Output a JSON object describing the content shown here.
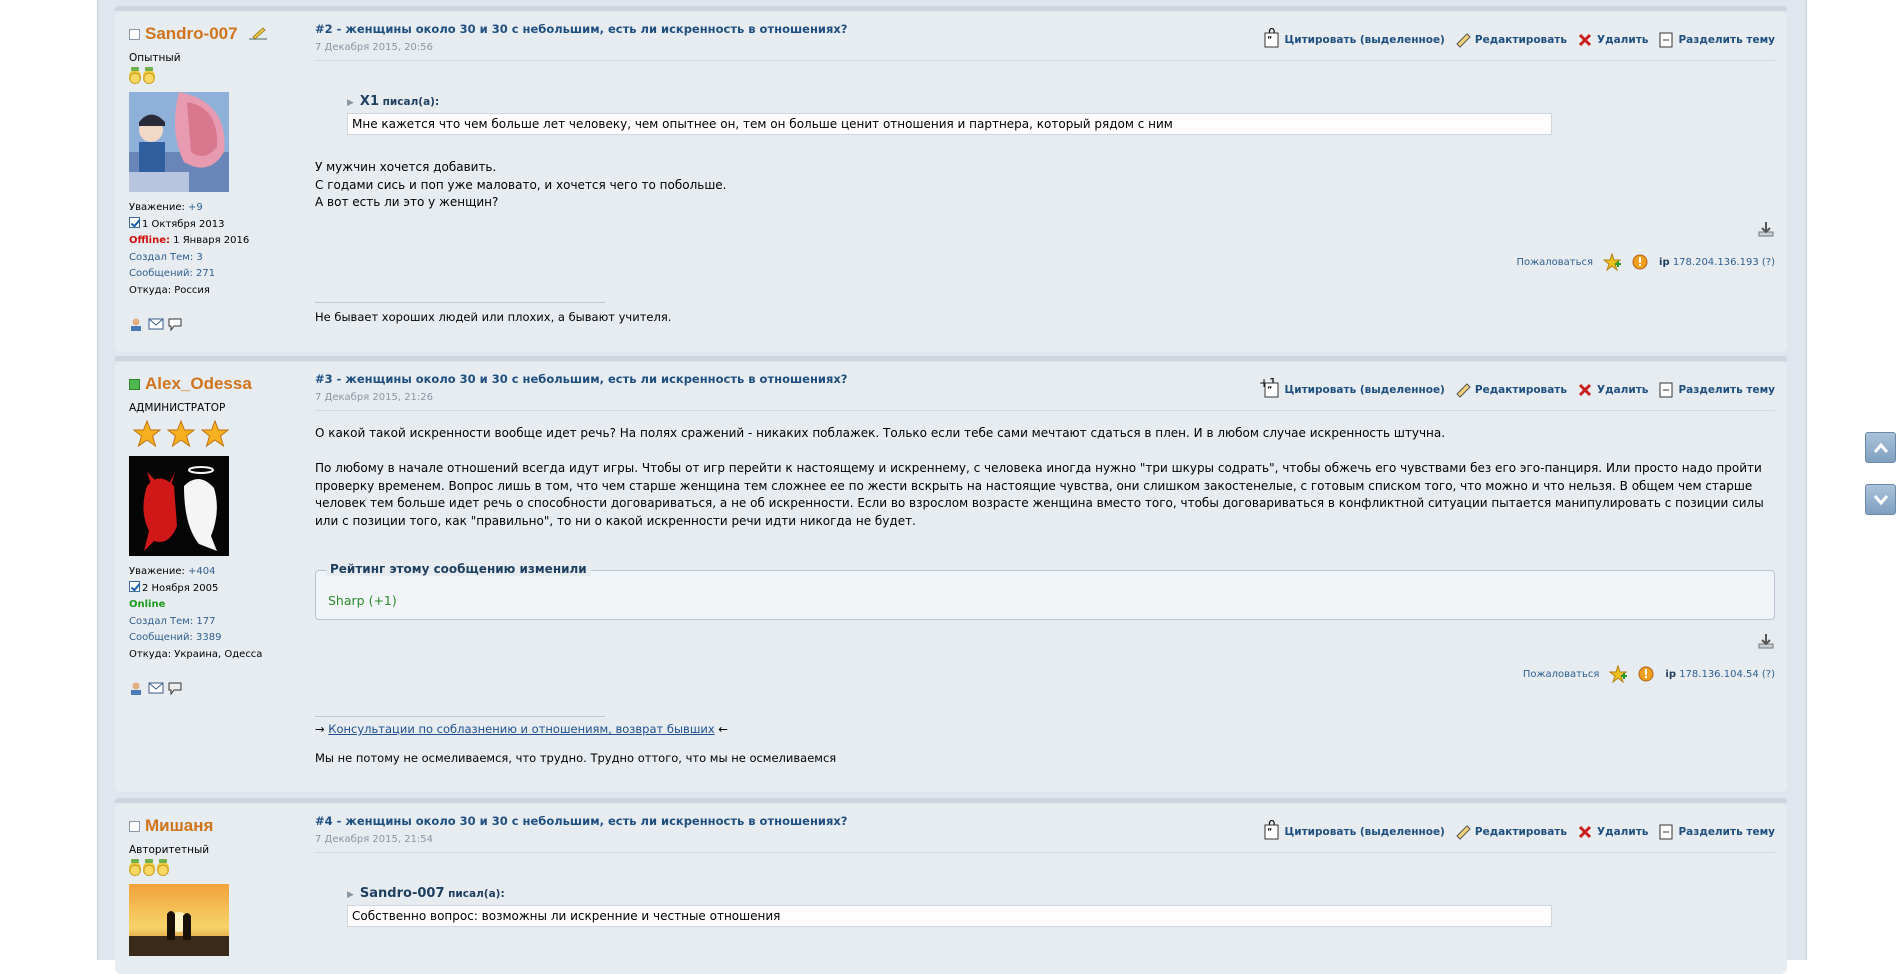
{
  "posts": [
    {
      "author": "Sandro-007",
      "group": "Опытный",
      "respect_label": "Уважение: ",
      "respect_value": "+9",
      "registered": "1 Октября 2013",
      "status_label": "Offline:",
      "status_value": " 1 Января 2016",
      "topics": "Создал Тем: 3",
      "messages": "Сообщений: 271",
      "from": "Откуда: Россия",
      "subject": "#2 - женщины около 30 и 30 с небольшим, есть ли искренность в отношениях?",
      "date": "7 Декабря 2015, 20:56",
      "score": "0",
      "quote_author": "X1",
      "quote_said": "писал(а):",
      "quote_text": "Мне кажется что чем больше лет человеку, чем опытнее он, тем он больше ценит отношения и партнера, который рядом с ним",
      "body_lines": [
        "У мужчин хочется добавить.",
        "С годами сись и поп уже маловато, и хочется чего то побольше.",
        "А вот есть ли это у женщин?"
      ],
      "report": "Пожаловаться",
      "ip": "178.204.136.193 (?)",
      "signature": "Не бывает хороших людей или плохих, а бывают учителя."
    },
    {
      "author": "Alex_Odessa",
      "group": "АДМИНИСТРАТОР",
      "respect_label": "Уважение: ",
      "respect_value": "+404",
      "registered": "2 Ноября 2005",
      "status_value": "Online",
      "topics": "Создал Тем: 177",
      "messages": "Сообщений: 3389",
      "from": "Откуда: Украина, Одесса",
      "subject": "#3 - женщины около 30 и 30 с небольшим, есть ли искренность в отношениях?",
      "date": "7 Декабря 2015, 21:26",
      "score": "+1",
      "body_p1": "О какой такой искренности вообще идет речь? На полях сражений - никаких поблажек. Только если тебе сами мечтают сдаться в плен. И в любом случае искренность штучна.",
      "body_p2": "По любому в начале отношений всегда идут игры. Чтобы от игр перейти к настоящему и искреннему, с человека иногда нужно \"три шкуры содрать\", чтобы обжечь его чувствами без его эго-панциря. Или просто надо пройти проверку временем. Вопрос лишь в том, что чем старше женщина тем сложнее ее по жести вскрыть на настоящие чувства, они слишком закостенелые, с готовым списком того, что можно и что нельзя. В общем чем старше человек тем больше идет речь о способности договариваться, а не об искренности. Если во взрослом возрасте женщина вместо того, чтобы договариваться в конфликтной ситуации пытается манипулировать с позиции силы или с позиции того, как \"правильно\", то ни о какой искренности речи идти никогда не будет.",
      "rating_title": "Рейтинг этому сообщению изменили",
      "rating_entry": "Sharp (+1)",
      "report": "Пожаловаться",
      "ip": "178.136.104.54 (?)",
      "sig_arrow_left": "→",
      "sig_link": "Консультации по соблазнению и отношениям, возврат бывших",
      "sig_arrow_right": "←",
      "signature2": "Мы не потому не осмеливаемся, что трудно. Трудно оттого, что мы не осмеливаемся"
    },
    {
      "author": "Мишаня",
      "group": "Авторитетный",
      "subject": "#4 - женщины около 30 и 30 с небольшим, есть ли искренность в отношениях?",
      "date": "7 Декабря 2015, 21:54",
      "score": "0",
      "quote_author": "Sandro-007",
      "quote_said": "писал(а):",
      "quote_text": "Собственно вопрос: возможны ли искренние и честные отношения"
    }
  ],
  "actions": {
    "quote": "Цитировать (выделенное)",
    "edit": "Редактировать",
    "delete": "Удалить",
    "split": "Разделить тему"
  },
  "ip_prefix": "ip",
  "colors": {
    "accent": "#1f4f7f",
    "username": "#d0741c",
    "post_bg": "#e7ecf1"
  }
}
